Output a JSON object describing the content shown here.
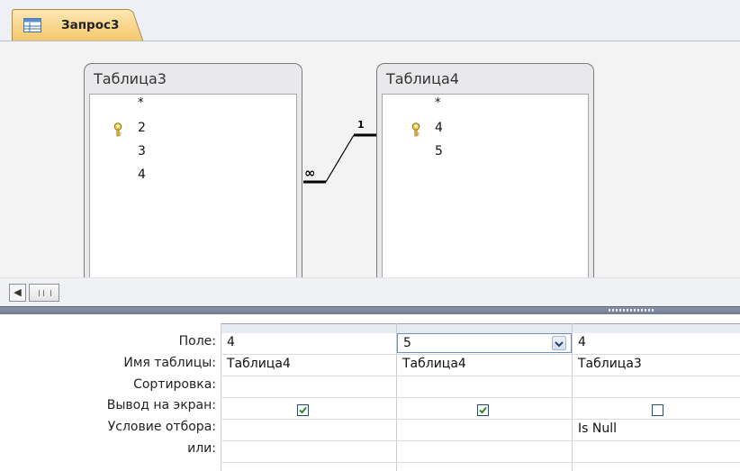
{
  "tab": {
    "title": "Запрос3",
    "icon": "query-icon"
  },
  "tables": [
    {
      "name": "Таблица3",
      "fields": [
        "*",
        "2",
        "3",
        "4"
      ],
      "key_field": "2"
    },
    {
      "name": "Таблица4",
      "fields": [
        "*",
        "4",
        "5"
      ],
      "key_field": "4"
    }
  ],
  "relationship": {
    "many_label": "∞",
    "one_label": "1"
  },
  "grid": {
    "row_labels": [
      "Поле:",
      "Имя таблицы:",
      "Сортировка:",
      "Вывод на экран:",
      "Условие отбора:",
      "или:"
    ],
    "columns": [
      {
        "field": "4",
        "table": "Таблица4",
        "sort": "",
        "show": true,
        "criteria": "",
        "or": ""
      },
      {
        "field": "5",
        "table": "Таблица4",
        "sort": "",
        "show": true,
        "criteria": "",
        "or": ""
      },
      {
        "field": "4",
        "table": "Таблица3",
        "sort": "",
        "show": false,
        "criteria": "Is Null",
        "or": ""
      }
    ]
  },
  "colors": {
    "accent_tab": "#f3c76a",
    "check": "#2a8a2a",
    "splitter": "#7a849a"
  }
}
